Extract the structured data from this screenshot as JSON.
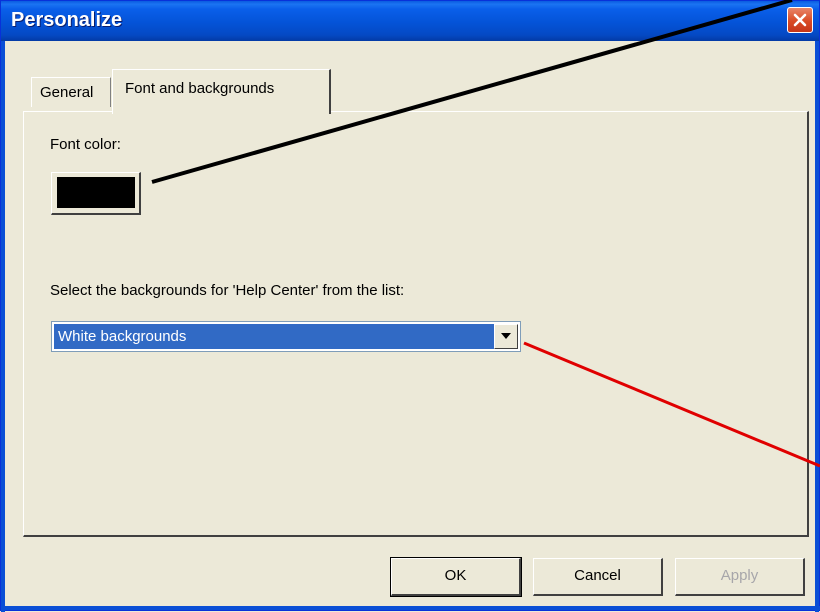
{
  "window": {
    "title": "Personalize"
  },
  "tabs": [
    {
      "label": "General"
    },
    {
      "label": "Font and backgrounds"
    }
  ],
  "panel": {
    "font_color_label": "Font color:",
    "font_color_value": "#000000",
    "backgrounds_label": "Select the backgrounds for 'Help Center' from the list:",
    "backgrounds_selected": "White backgrounds"
  },
  "buttons": {
    "ok": "OK",
    "cancel": "Cancel",
    "apply": "Apply"
  },
  "icons": {
    "close": "close-icon",
    "dropdown": "chevron-down-icon"
  },
  "annotations": {
    "line1_color": "#000000",
    "line2_color": "#e00000"
  }
}
